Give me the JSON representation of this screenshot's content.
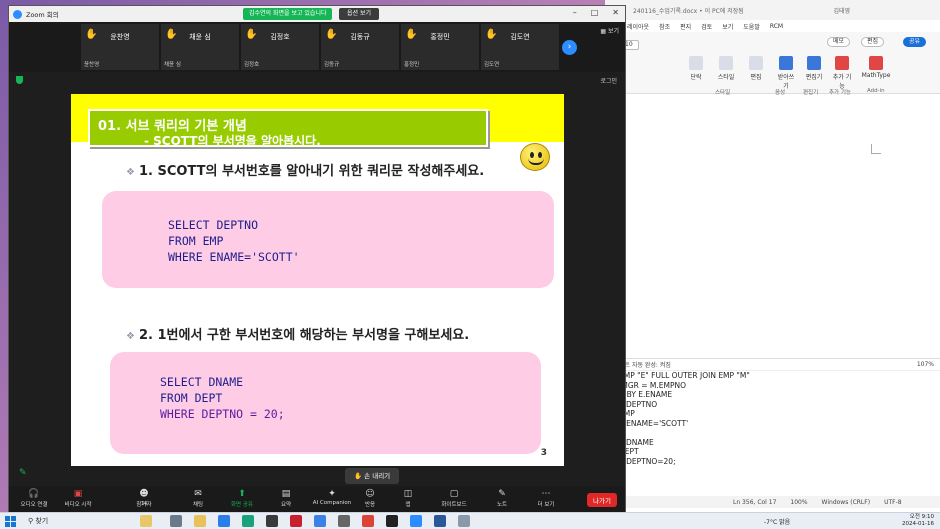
{
  "word": {
    "title": "240116_수업기록.docx • 이 PC에 저장됨",
    "user": "김태영",
    "tabs": [
      "레이아웃",
      "참조",
      "편지",
      "검토",
      "보기",
      "도움말",
      "RCM"
    ],
    "font_size": "10",
    "ribbon_buttons": [
      "단락",
      "스타일",
      "편집",
      "받아쓰기",
      "편집기",
      "추가 기능",
      "MathType"
    ],
    "ribbon_groups": [
      "스타일",
      "음성",
      "편집기",
      "추가 기능",
      "Add-in"
    ],
    "comment_btn": "메모",
    "edit_btn": "편집",
    "share_btn": "공유",
    "pane_header": "스트 자동 완성: 켜짐",
    "zoom_level": "107%",
    "code_lines": [
      "EMP \"E\" FULL OUTER JOIN EMP \"M\"",
      ".MGR = M.EMPNO",
      "R BY E.ENAME",
      "",
      "T DEPTNO",
      "EMP",
      "E ENAME='SCOTT'",
      "",
      "T DNAME",
      "DEPT",
      "E DEPTNO=20;"
    ],
    "status": [
      "Ln 356, Col 17",
      "100%",
      "Windows (CRLF)",
      "UTF-8"
    ]
  },
  "zoom": {
    "window_title": "Zoom 회의",
    "banner": "김수연의 화면을 보고 있습니다",
    "view_options": "옵션 보기",
    "view_label": "보기",
    "signin": "로그인",
    "participants": [
      {
        "name": "윤찬영",
        "sub": "윤찬영"
      },
      {
        "name": "채윤 심",
        "sub": "채윤 심"
      },
      {
        "name": "김정호",
        "sub": "김정호"
      },
      {
        "name": "김동규",
        "sub": "김동규"
      },
      {
        "name": "홍정민",
        "sub": "홍정민"
      },
      {
        "name": "김도연",
        "sub": "김도연"
      }
    ],
    "lower_hand": "손 내리기",
    "toolbar": [
      {
        "label": "오디오 연결",
        "icon": "headphones-icon"
      },
      {
        "label": "비디오 시작",
        "icon": "video-off-icon"
      },
      {
        "label": "참가자",
        "icon": "participants-icon",
        "count": "14"
      },
      {
        "label": "채팅",
        "icon": "chat-icon"
      },
      {
        "label": "화면 공유",
        "icon": "share-screen-icon"
      },
      {
        "label": "요약",
        "icon": "summary-icon"
      },
      {
        "label": "AI Companion",
        "icon": "ai-companion-icon"
      },
      {
        "label": "반응",
        "icon": "reaction-icon"
      },
      {
        "label": "앱",
        "icon": "apps-icon"
      },
      {
        "label": "화이트보드",
        "icon": "whiteboard-icon"
      },
      {
        "label": "노트",
        "icon": "notes-icon"
      },
      {
        "label": "더 보기",
        "icon": "more-icon"
      }
    ],
    "leave": "나가기"
  },
  "slide": {
    "title_line1": "01. 서브 쿼리의 기본 개념",
    "title_line2": "- SCOTT의 부서명을 알아봅시다.",
    "q1": "1. SCOTT의 부서번호를 알아내기 위한 쿼리문 작성해주세요.",
    "code1": [
      "SELECT DEPTNO",
      "FROM EMP",
      "WHERE ENAME='SCOTT'"
    ],
    "q2": "2. 1번에서 구한 부서번호에 해당하는 부서명을 구해보세요.",
    "code2": [
      "SELECT DNAME",
      "FROM DEPT",
      "WHERE DEPTNO = 20;"
    ],
    "page": "3"
  },
  "taskbar": {
    "search": "찾기",
    "weather": "-7°C 맑음",
    "time": "오전 9:10",
    "date": "2024-01-16"
  },
  "colors": {
    "slide_title_bg": "#99cc00",
    "slide_top_band": "#ffff00",
    "code_box": "#ffcce6",
    "zoom_green": "#16b656",
    "zoom_blue": "#2d8cff",
    "leave_red": "#e02828"
  }
}
